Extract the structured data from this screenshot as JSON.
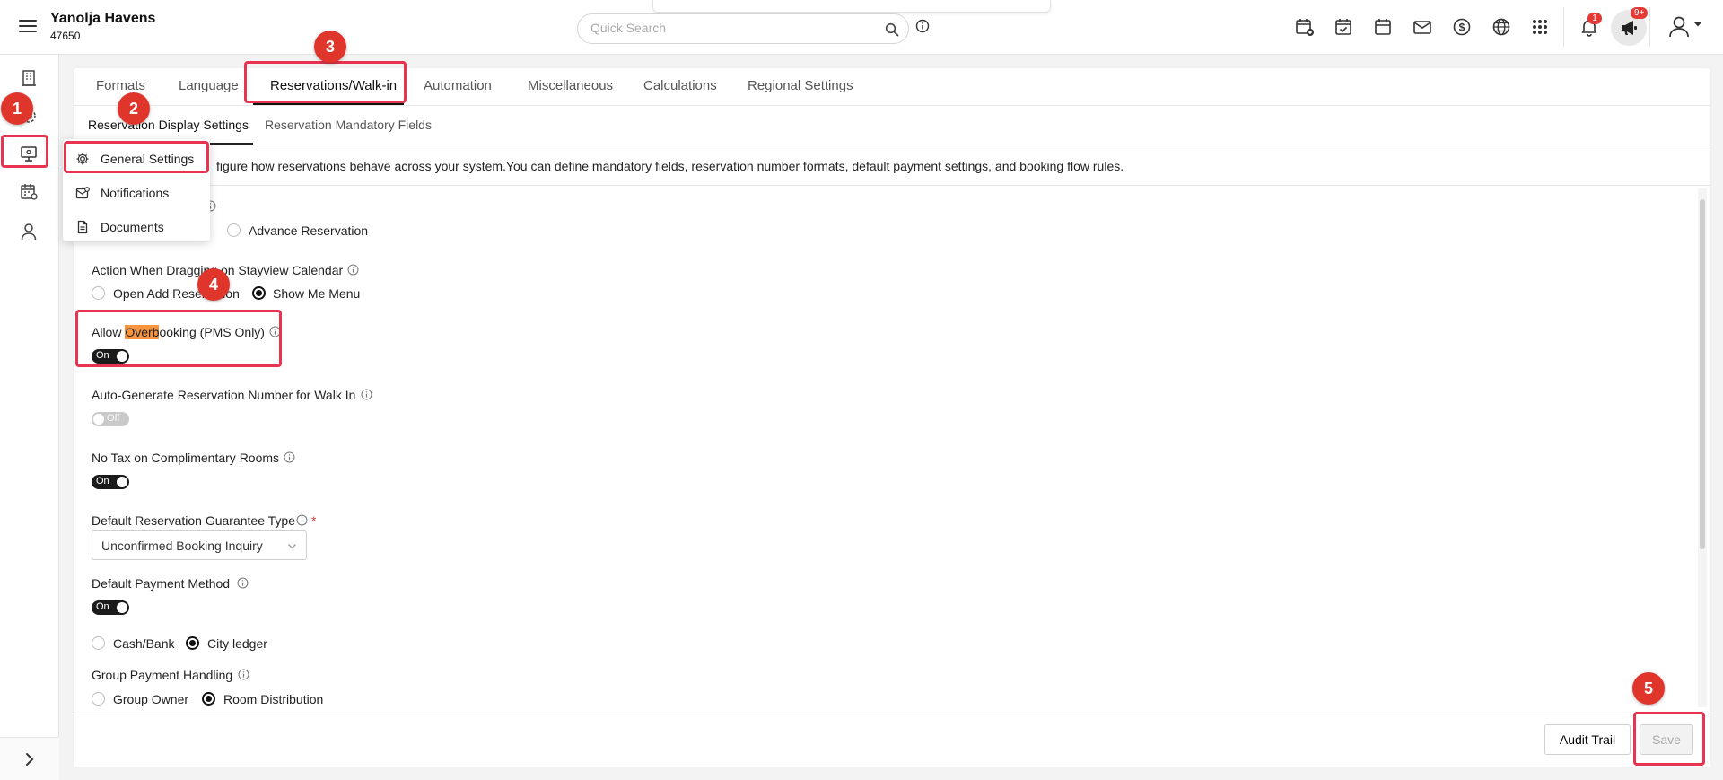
{
  "header": {
    "hotel_name": "Yanolja Havens",
    "hotel_id": "47650",
    "search_placeholder": "Quick Search",
    "notification_count": "1",
    "announcement_count": "9+"
  },
  "icons": {
    "top": [
      "calendar-add-icon",
      "calendar-check-icon",
      "calendar-icon",
      "mail-icon",
      "dollar-icon",
      "globe-icon",
      "apps-grid-icon",
      "bell-icon",
      "megaphone-icon",
      "user-icon"
    ],
    "rail": [
      "building-icon",
      "settings-icon",
      "monitor-icon",
      "calendar-list-icon",
      "user-icon"
    ]
  },
  "tabs": [
    "Formats",
    "Language",
    "Reservations/Walk-in",
    "Automation",
    "Miscellaneous",
    "Calculations",
    "Regional Settings"
  ],
  "subtabs": [
    "Reservation Display Settings",
    "Reservation Mandatory Fields"
  ],
  "description": "figure how reservations behave across your system.You can define mandatory fields, reservation number formats, default payment settings, and booking flow rules.",
  "menu": {
    "items": [
      "General Settings",
      "Notifications",
      "Documents"
    ]
  },
  "settings": {
    "partial_radio_label": "n",
    "advance_reservation": "Advance Reservation",
    "drag_action": {
      "label": "Action When Dragging on Stayview Calendar",
      "options": [
        "Open Add Reservation",
        "Show Me Menu"
      ],
      "selected": "Show Me Menu"
    },
    "overbooking": {
      "label_pre": "Allow ",
      "label_highlight": "Overb",
      "label_post": "ooking (PMS Only)",
      "state": "On"
    },
    "auto_generate": {
      "label": "Auto-Generate Reservation Number for Walk In",
      "state": "Off"
    },
    "no_tax": {
      "label": "No Tax on Complimentary Rooms",
      "state": "On"
    },
    "guarantee": {
      "label": "Default Reservation Guarantee Type",
      "required": "*",
      "value": "Unconfirmed Booking Inquiry"
    },
    "payment_method": {
      "label": "Default Payment Method",
      "state": "On",
      "options": [
        "Cash/Bank",
        "City ledger"
      ],
      "selected": "City ledger"
    },
    "group_payment": {
      "label": "Group Payment Handling",
      "options": [
        "Group Owner",
        "Room Distribution"
      ],
      "selected": "Room Distribution"
    }
  },
  "footer": {
    "audit_trail": "Audit Trail",
    "save": "Save"
  },
  "annotations": [
    "1",
    "2",
    "3",
    "4",
    "5"
  ],
  "colors": {
    "accent": "#e8344f",
    "highlight": "#f7943d",
    "badge": "#e53935",
    "toggle_on": "#1b1b1b"
  }
}
